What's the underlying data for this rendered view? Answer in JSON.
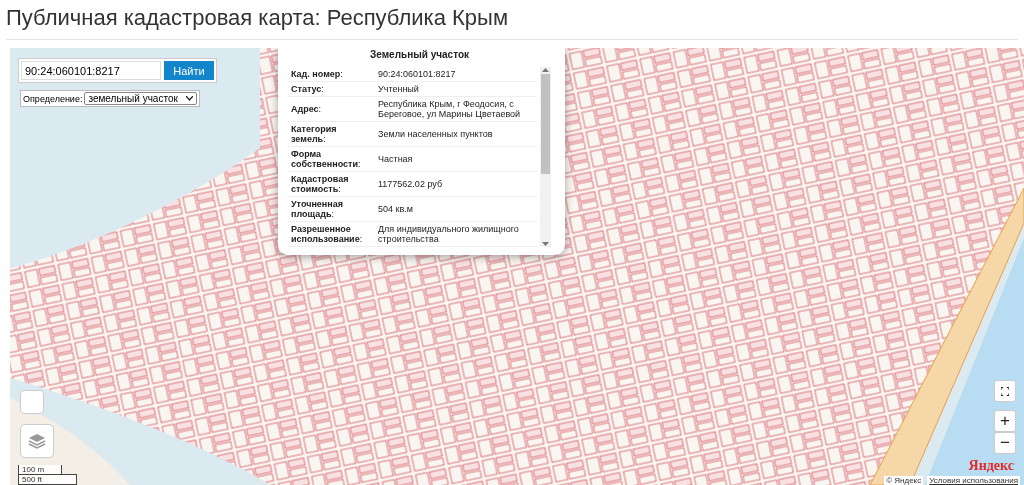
{
  "page": {
    "title": "Публичная кадастровая карта: Республика Крым"
  },
  "search": {
    "value": "90:24:060101:8217",
    "button": "Найти"
  },
  "definition": {
    "label": "Определение:",
    "value": "земельный участок"
  },
  "popup": {
    "title": "Земельный участок",
    "rows": [
      {
        "label": "**Кад. номер**:",
        "value": "90:24:060101:8217"
      },
      {
        "label": "**Статус**:",
        "value": "Учтенный"
      },
      {
        "label": "**Адрес**:",
        "value": "Республика Крым, г Феодосия, с Береговое, ул Марины Цветаевой"
      },
      {
        "label": "**Категория земель**:",
        "value": "Земли населенных пунктов"
      },
      {
        "label": "**Форма собственности**:",
        "value": "Частная"
      },
      {
        "label": "**Кадастровая стоимость**:",
        "value": "1177562.02 руб"
      },
      {
        "label": "**Уточненная площадь**:",
        "value": "504 кв.м"
      },
      {
        "label": "**Разрешенное использование**:",
        "value": "Для индивидуального жилищного строительства"
      }
    ]
  },
  "scale": [
    "100 m",
    "500 ft"
  ],
  "zoom": {
    "in": "+",
    "out": "−"
  },
  "attribution": {
    "logo": "Яндекс",
    "copyright": "© Яндекс",
    "terms": "Условия использования"
  }
}
